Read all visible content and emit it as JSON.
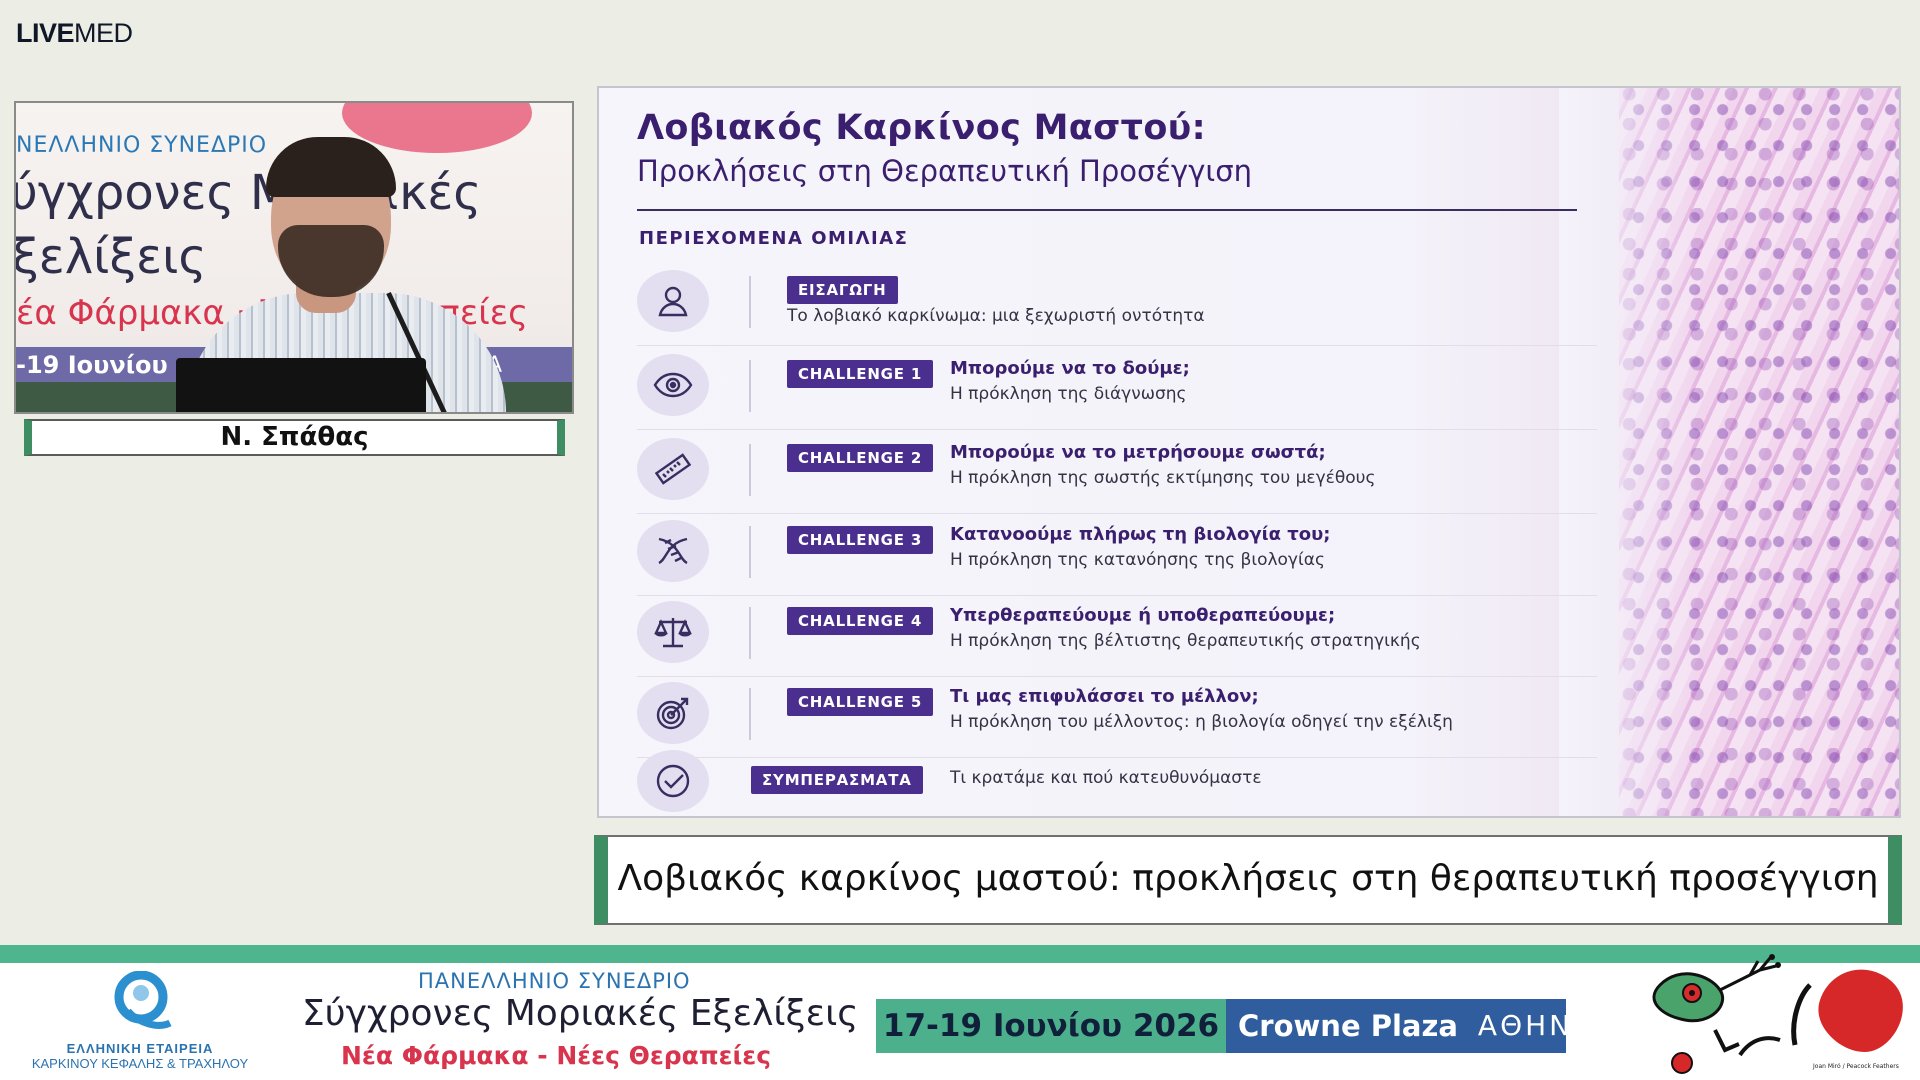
{
  "brand": {
    "bold": "LIVE",
    "light": "MED"
  },
  "speaker": {
    "name": "Ν. Σπάθας",
    "backdrop": {
      "line1": "ΝΕΛΛΗΝΙΟ ΣΥΝΕΔΡΙΟ",
      "line2": "ύγχρονες Μοριακές",
      "line3": "ξελίξεις",
      "line4": "έα Φάρμακα · Νέες Θεραπείες",
      "strip": "-19 Ιουνίου",
      "strip_right": "Α"
    }
  },
  "slide": {
    "title": "Λοβιακός Καρκίνος Μαστού:",
    "subtitle": "Προκλήσεις στη Θεραπευτική Προσέγγιση",
    "toc_heading": "ΠΕΡΙΕΧΟΜΕΝΑ ΟΜΙΛΙΑΣ",
    "items": [
      {
        "icon": "person-icon",
        "badge": "ΕΙΣΑΓΩΓΗ",
        "headline": "",
        "detail": "Το λοβιακό καρκίνωμα: μια ξεχωριστή οντότητα"
      },
      {
        "icon": "eye-icon",
        "badge": "CHALLENGE 1",
        "headline": "Μπορούμε να το δούμε;",
        "detail": "Η πρόκληση της διάγνωσης"
      },
      {
        "icon": "ruler-icon",
        "badge": "CHALLENGE 2",
        "headline": "Μπορούμε να το μετρήσουμε σωστά;",
        "detail": "Η πρόκληση της σωστής εκτίμησης του μεγέθους"
      },
      {
        "icon": "dna-icon",
        "badge": "CHALLENGE 3",
        "headline": "Κατανοούμε πλήρως τη βιολογία του;",
        "detail": "Η πρόκληση της κατανόησης της βιολογίας"
      },
      {
        "icon": "scales-icon",
        "badge": "CHALLENGE 4",
        "headline": "Υπερθεραπεύουμε ή υποθεραπεύουμε;",
        "detail": "Η πρόκληση της βέλτιστης θεραπευτικής στρατηγικής"
      },
      {
        "icon": "target-icon",
        "badge": "CHALLENGE 5",
        "headline": "Τι μας επιφυλάσσει το μέλλον;",
        "detail": "Η πρόκληση του μέλλοντος: η βιολογία οδηγεί την εξέλιξη"
      },
      {
        "icon": "check-circle-icon",
        "badge": "ΣΥΜΠΕΡΑΣΜΑΤΑ",
        "headline": "",
        "detail": "Τι κρατάμε και πού κατευθυνόμαστε"
      }
    ]
  },
  "caption": "Λοβιακός καρκίνος μαστού: προκλήσεις στη θεραπευτική προσέγγιση",
  "footer": {
    "society_line1": "ΕΛΛΗΝΙΚΗ ΕΤΑΙΡΕΙΑ",
    "society_line2": "ΚΑΡΚΙΝΟΥ ΚΕΦΑΛΗΣ & ΤΡΑΧΗΛΟΥ",
    "conf_overline": "ΠΑΝΕΛΛΗΝΙΟ ΣΥΝΕΔΡΙΟ",
    "conf_title": "Σύγχρονες Μοριακές Εξελίξεις",
    "conf_tagline": "Νέα Φάρμακα - Νέες Θεραπείες",
    "dates": "17-19 Ιουνίου 2026",
    "venue": "Crowne Plaza",
    "city": "ΑΘΗΝΑ",
    "art_credit": "Joan Miró / Peacock Feathers"
  },
  "colors": {
    "slide_purple": "#3a1f6e",
    "badge_purple": "#4b2f8f",
    "accent_green": "#4eb58f",
    "venue_blue": "#2f5d9d",
    "conf_red": "#d8344d"
  }
}
